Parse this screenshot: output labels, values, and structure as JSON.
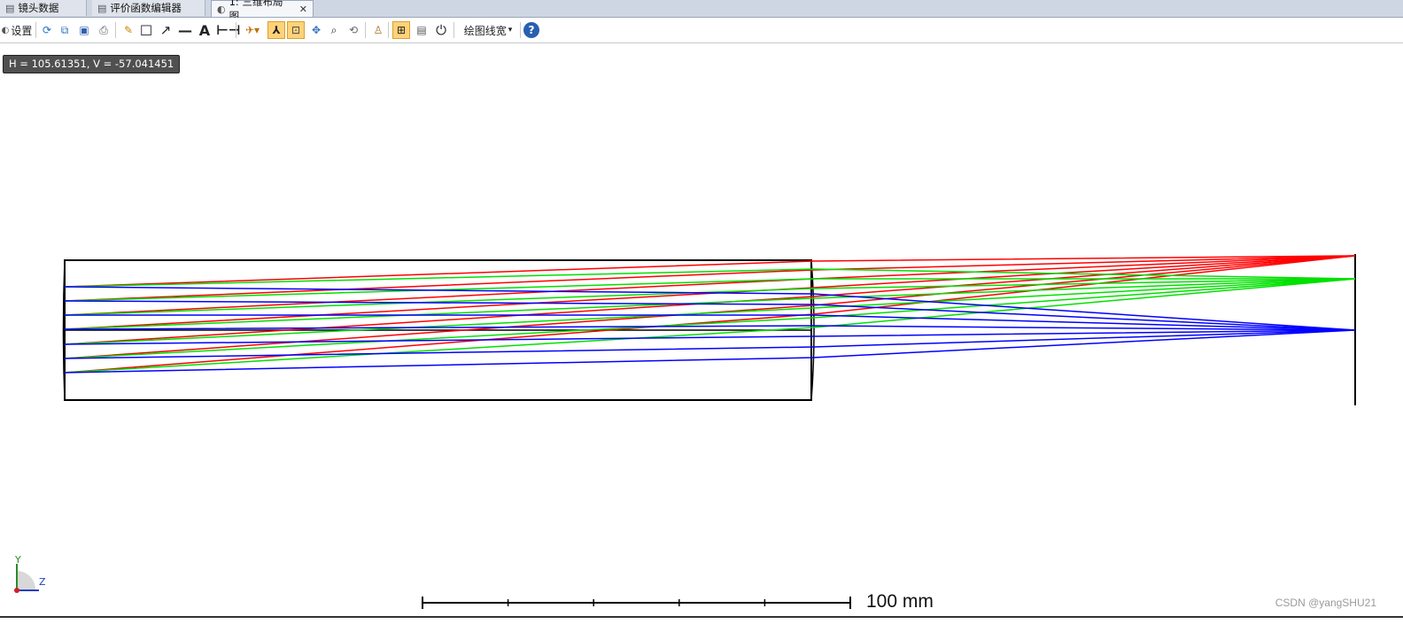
{
  "tabs": [
    {
      "label": "镜头数据",
      "icon": "document-icon"
    },
    {
      "label": "评价函数编辑器",
      "icon": "document-icon"
    },
    {
      "label": "1: 三维布局图",
      "icon": "layout-3d-icon",
      "active": true
    }
  ],
  "toolbar": {
    "settings_label": "设置",
    "linewidth_label": "绘图线宽",
    "icons": [
      "refresh-icon",
      "copy-icon",
      "save-icon",
      "print-icon",
      "pencil-icon",
      "rectangle-icon",
      "arrow-icon",
      "line-icon",
      "text-icon",
      "dimension-icon",
      "rotate-icon",
      "axes-icon",
      "zoom-window-icon",
      "pan-icon",
      "zoom-icon",
      "reset-view-icon",
      "stamp-icon",
      "fit-icon",
      "export-icon",
      "power-icon",
      "help-icon"
    ]
  },
  "coord_readout": "H = 105.61351, V = -57.041451",
  "axes": {
    "y": "Y",
    "z": "Z"
  },
  "scale_bar": {
    "label": "100 mm",
    "ticks": 5
  },
  "watermark": "CSDN @yangSHU21",
  "colors": {
    "ray_red": "#ff0000",
    "ray_green": "#00e000",
    "ray_blue": "#0000ff",
    "outline": "#000000",
    "selected": "#ffd27a"
  },
  "chart_data": {
    "type": "line",
    "title": "",
    "series": [
      {
        "name": "",
        "color": "#ff0000",
        "field": "upper"
      },
      {
        "name": "",
        "color": "#00e000",
        "field": "middle"
      },
      {
        "name": "",
        "color": "#0000ff",
        "field": "axial"
      }
    ],
    "fields": {
      "upper": {
        "starts": [
          324,
          340,
          356,
          372,
          389,
          405,
          421
        ],
        "exit_top": 295,
        "exit_bottom": 355,
        "image": 289
      },
      "middle": {
        "starts": [
          324,
          340,
          356,
          372,
          389,
          405,
          421
        ],
        "exit_top": 304,
        "exit_bottom": 370,
        "image": 315
      },
      "axial": {
        "starts": [
          324,
          340,
          356,
          372,
          389,
          405,
          421
        ],
        "exit_top": 332,
        "exit_bottom": 404,
        "image": 373
      }
    }
  }
}
